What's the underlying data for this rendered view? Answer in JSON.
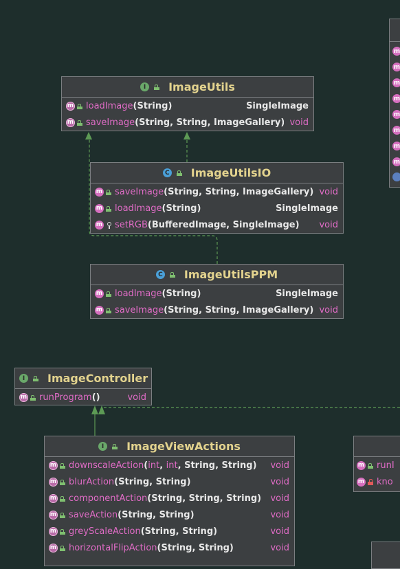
{
  "classes": {
    "image_utils": {
      "title": "ImageUtils",
      "kind": "interface",
      "methods": [
        {
          "name": "loadImage",
          "params": "(String)",
          "ret": "SingleImage",
          "ret_kind": "type"
        },
        {
          "name": "saveImage",
          "params": "(String, String, ImageGallery)",
          "ret": "void",
          "ret_kind": "prim"
        }
      ]
    },
    "image_utils_io": {
      "title": "ImageUtilsIO",
      "kind": "class",
      "methods": [
        {
          "name": "saveImage",
          "params": "(String, String, ImageGallery)",
          "ret": "void",
          "ret_kind": "prim"
        },
        {
          "name": "loadImage",
          "params": "(String)",
          "ret": "SingleImage",
          "ret_kind": "type"
        },
        {
          "name": "setRGB",
          "params": "(BufferedImage, SingleImage)",
          "ret": "void",
          "ret_kind": "prim"
        }
      ]
    },
    "image_utils_ppm": {
      "title": "ImageUtilsPPM",
      "kind": "class",
      "methods": [
        {
          "name": "loadImage",
          "params": "(String)",
          "ret": "SingleImage",
          "ret_kind": "type"
        },
        {
          "name": "saveImage",
          "params": "(String, String, ImageGallery)",
          "ret": "void",
          "ret_kind": "prim"
        }
      ]
    },
    "image_controller": {
      "title": "ImageController",
      "kind": "interface",
      "methods": [
        {
          "name": "runProgram",
          "params": "()",
          "ret": "void",
          "ret_kind": "prim"
        }
      ]
    },
    "image_view_actions": {
      "title": "ImageViewActions",
      "kind": "interface",
      "methods": [
        {
          "name": "downscaleAction",
          "p1": "(",
          "prim1": "int",
          "sep1": ", ",
          "prim2": "int",
          "p2": ", String, String)",
          "ret": "void",
          "ret_kind": "prim"
        },
        {
          "name": "blurAction",
          "params": "(String, String)",
          "ret": "void",
          "ret_kind": "prim"
        },
        {
          "name": "componentAction",
          "params": "(String, String, String)",
          "ret": "void",
          "ret_kind": "prim"
        },
        {
          "name": "saveAction",
          "params": "(String, String)",
          "ret": "void",
          "ret_kind": "prim"
        },
        {
          "name": "greyScaleAction",
          "params": "(String, String)",
          "ret": "void",
          "ret_kind": "prim"
        },
        {
          "name": "horizontalFlipAction",
          "params": "(String, String)",
          "ret": "void",
          "ret_kind": "prim"
        }
      ]
    },
    "partial_right_lower": {
      "rows": [
        {
          "name": "runI"
        },
        {
          "name": "kno"
        }
      ]
    }
  },
  "badges": {
    "interface": "I",
    "class": "C",
    "method": "m"
  },
  "colors": {
    "background": "#1e2e2c",
    "box": "#3c3f41",
    "title": "#e3d38e",
    "method_name": "#e06cc6",
    "edge": "#5d9a55"
  }
}
